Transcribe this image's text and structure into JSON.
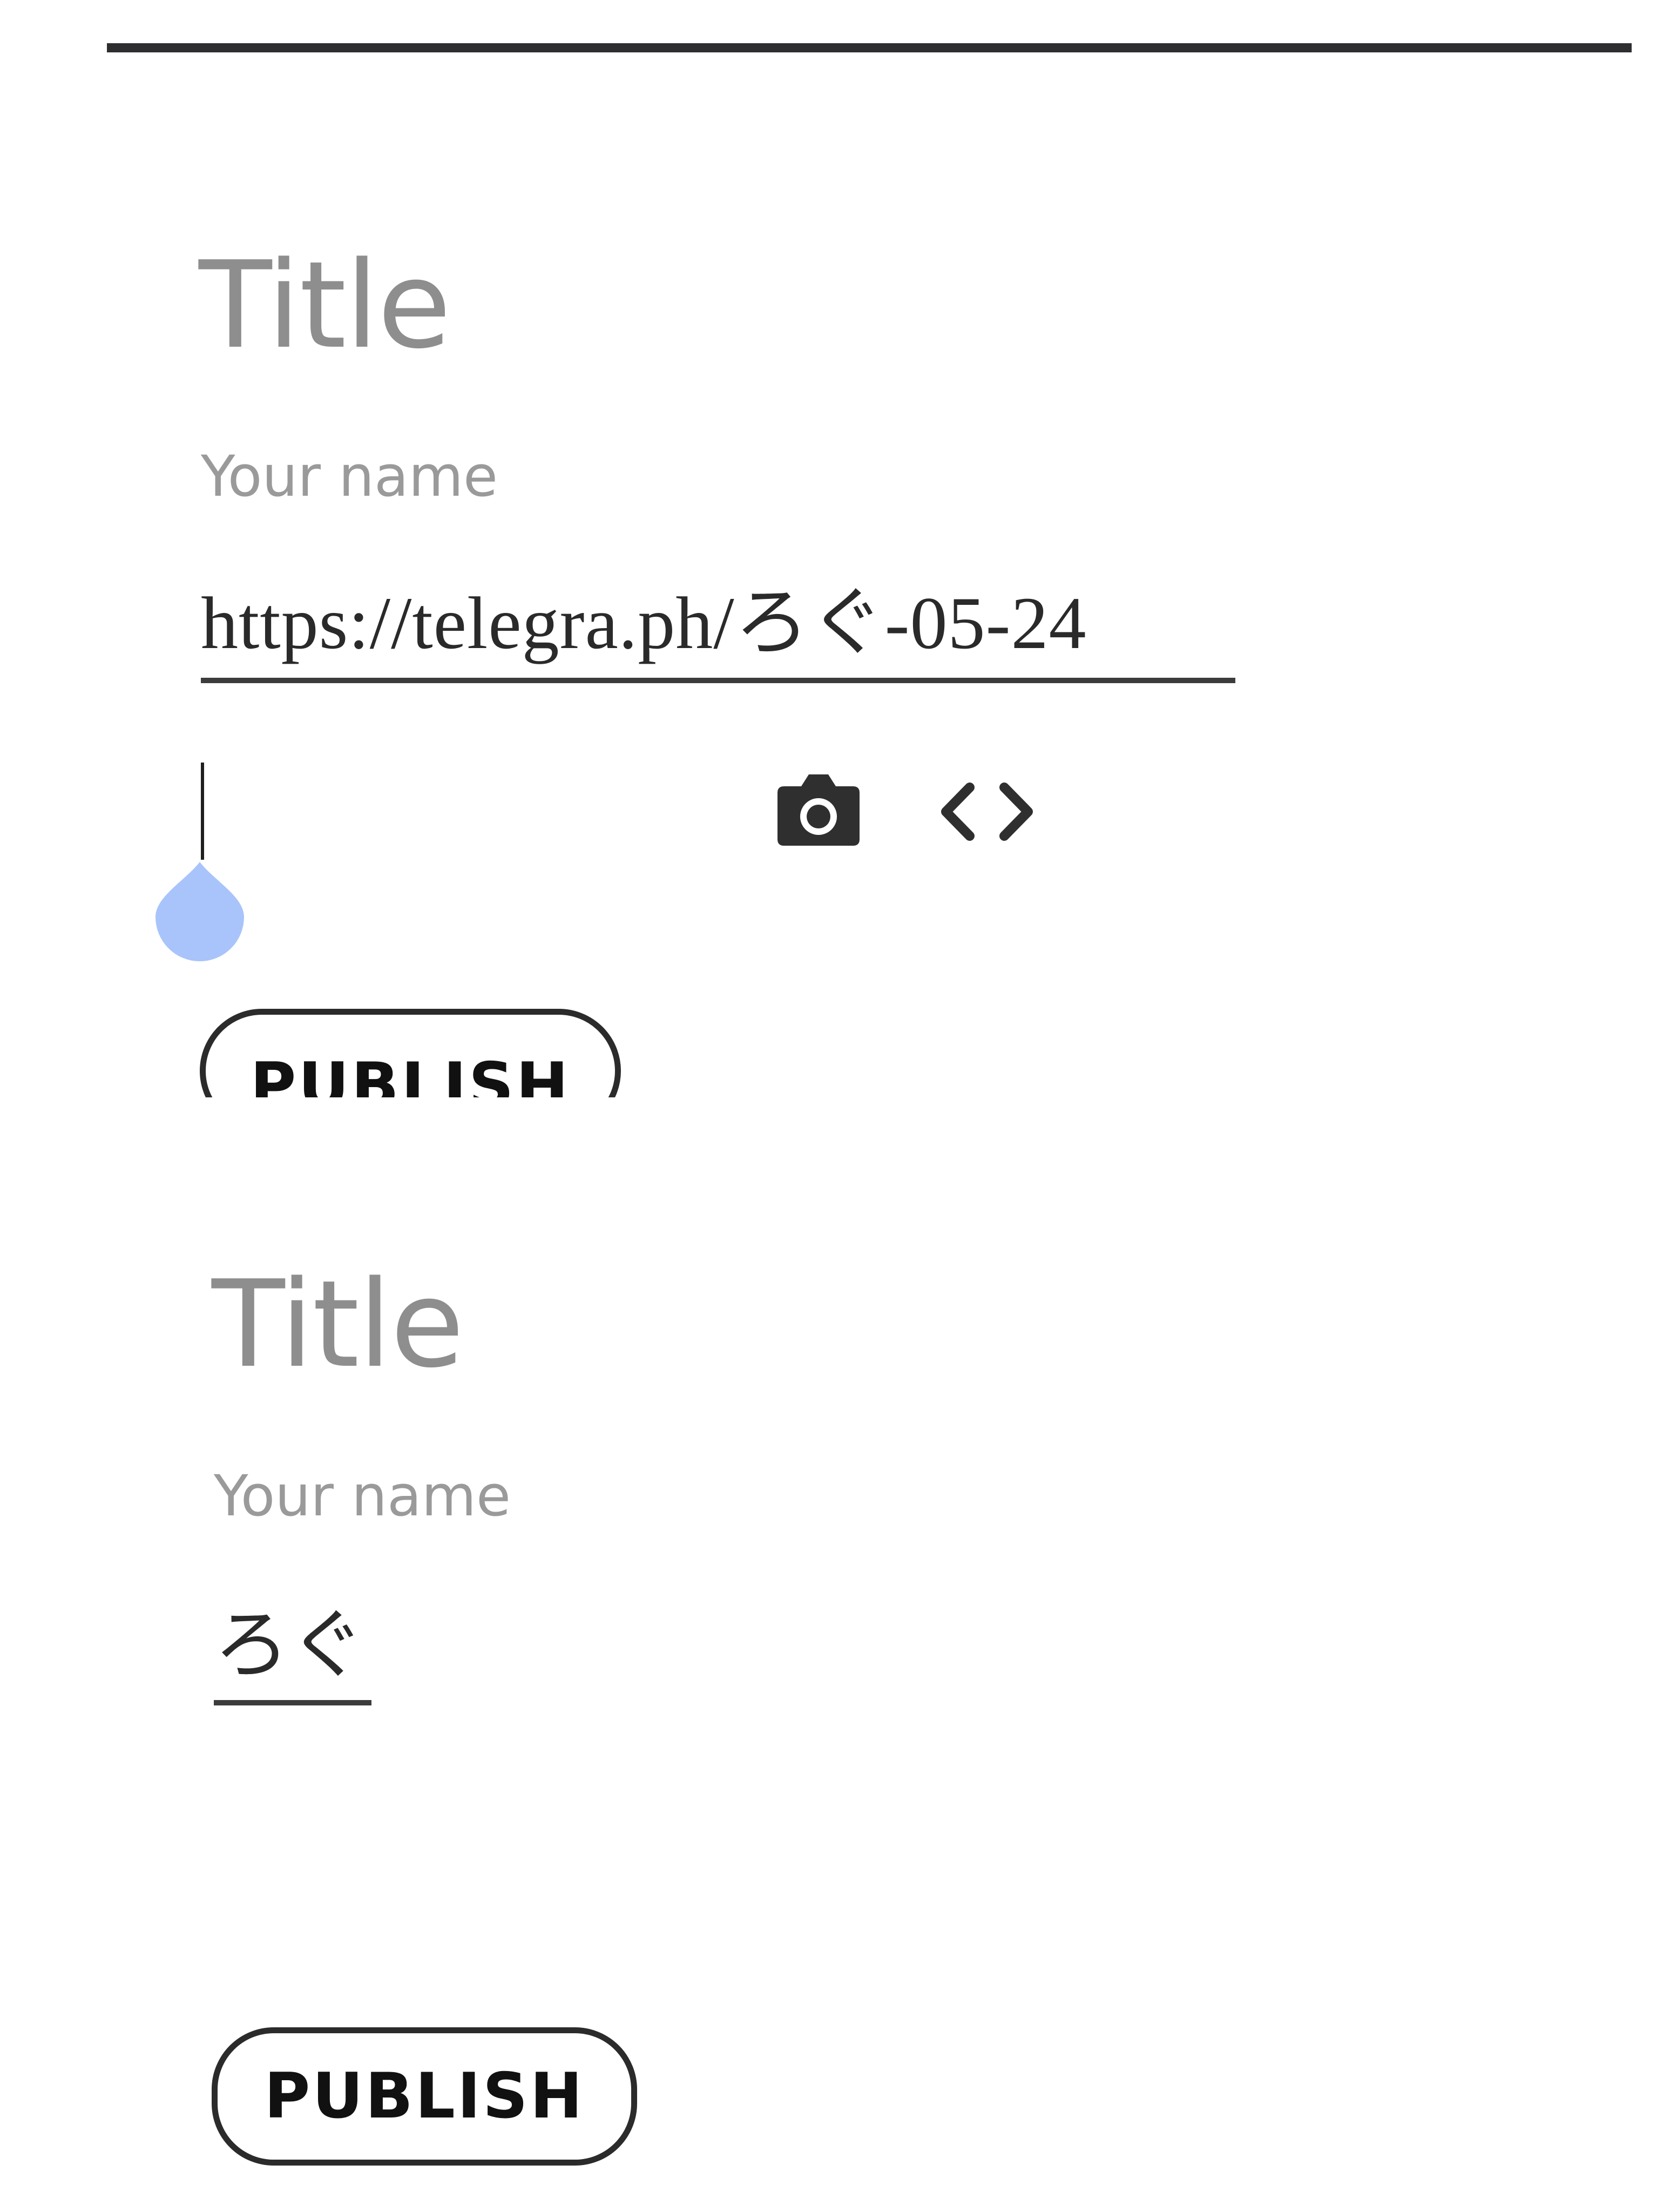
{
  "screen_top": {
    "title_placeholder": "Title",
    "author_placeholder": "Your name",
    "link_value": "https://telegra.ph/ろぐ-05-24",
    "publish_label": "PUBLISH"
  },
  "screen_bottom": {
    "title_placeholder": "Title",
    "author_placeholder": "Your name",
    "link_value": "ろぐ",
    "publish_label": "PUBLISH"
  },
  "toolbar": {
    "image_icon": "camera-icon",
    "embed_icon": "code-icon"
  },
  "colors": {
    "placeholder": "#8e8e8e",
    "text": "#2a2a2a",
    "caret_handle": "#a9c4fa",
    "button_border": "#2b2b2b"
  }
}
